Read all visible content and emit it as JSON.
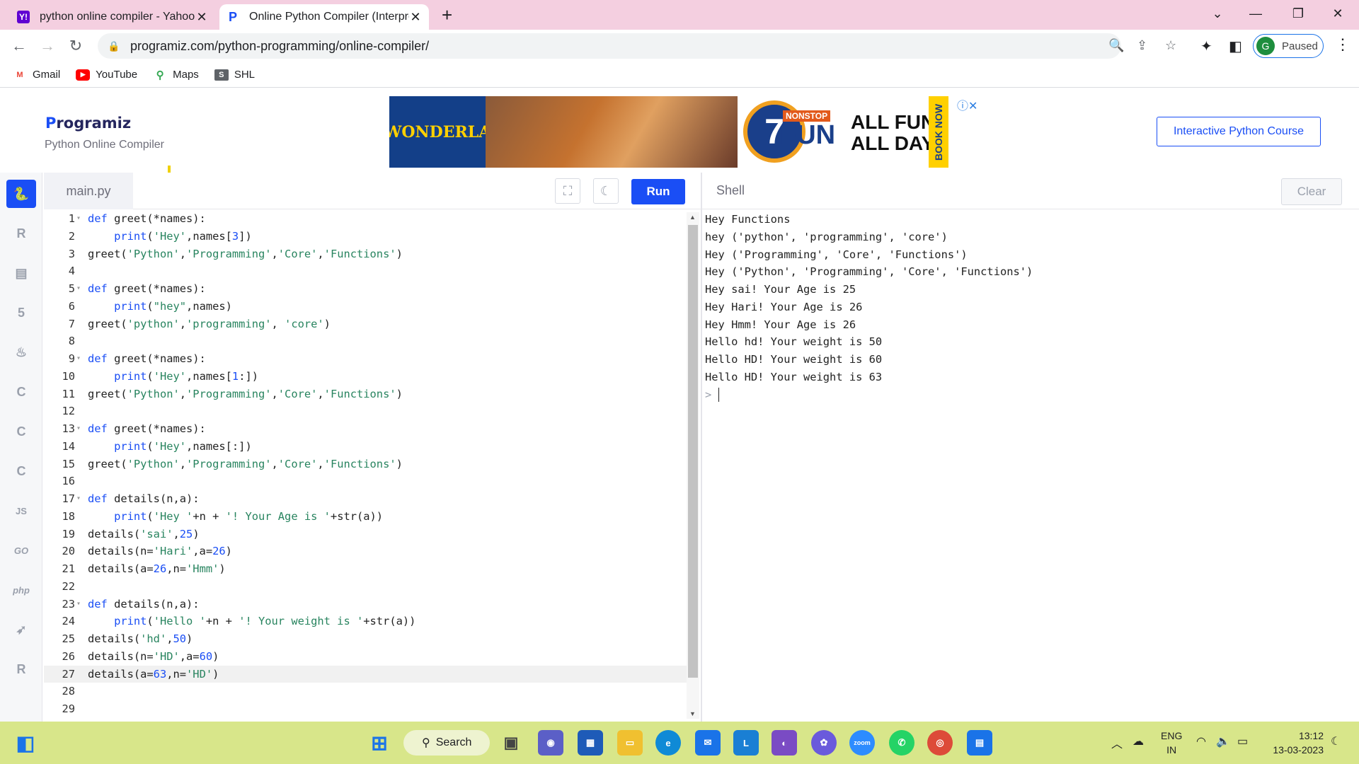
{
  "browser": {
    "tabs": [
      {
        "title": "python online compiler - Yahoo",
        "favicon": "Y!",
        "color": "#6001d2"
      },
      {
        "title": "Online Python Compiler (Interpre",
        "favicon": "P",
        "color": "#1a4ef5"
      }
    ],
    "url": "programiz.com/python-programming/online-compiler/",
    "profile": {
      "initial": "G",
      "label": "Paused"
    },
    "bookmarks": [
      {
        "label": "Gmail",
        "icon": "gmail-icon"
      },
      {
        "label": "YouTube",
        "icon": "youtube-icon"
      },
      {
        "label": "Maps",
        "icon": "maps-icon"
      },
      {
        "label": "SHL",
        "icon": "shl-icon"
      }
    ]
  },
  "site": {
    "logo": "Programiz",
    "subtitle": "Python Online Compiler",
    "course_button": "Interactive Python Course",
    "ad": {
      "brand": "WONDERLA",
      "number": "7",
      "badge": "NONSTOP",
      "fun": "FUN",
      "tagline": "ALL FUN, ALL DAY.",
      "cta": "BOOK NOW"
    }
  },
  "editor": {
    "filename": "main.py",
    "run_label": "Run",
    "current_line": 27,
    "lines": [
      {
        "n": "1",
        "fold": true,
        "html": "<span class=\"kw\">def</span> greet(*names):"
      },
      {
        "n": "2",
        "html": "    <span class=\"kw\">print</span>(<span class=\"str\">'Hey'</span>,names[<span class=\"nm\">3</span>])"
      },
      {
        "n": "3",
        "html": "greet(<span class=\"str\">'Python'</span>,<span class=\"str\">'Programming'</span>,<span class=\"str\">'Core'</span>,<span class=\"str\">'Functions'</span>)"
      },
      {
        "n": "4",
        "html": ""
      },
      {
        "n": "5",
        "fold": true,
        "html": "<span class=\"kw\">def</span> greet(*names):"
      },
      {
        "n": "6",
        "html": "    <span class=\"kw\">print</span>(<span class=\"str\">\"hey\"</span>,names)"
      },
      {
        "n": "7",
        "html": "greet(<span class=\"str\">'python'</span>,<span class=\"str\">'programming'</span>, <span class=\"str\">'core'</span>)"
      },
      {
        "n": "8",
        "html": ""
      },
      {
        "n": "9",
        "fold": true,
        "html": "<span class=\"kw\">def</span> greet(*names):"
      },
      {
        "n": "10",
        "html": "    <span class=\"kw\">print</span>(<span class=\"str\">'Hey'</span>,names[<span class=\"nm\">1</span>:])"
      },
      {
        "n": "11",
        "html": "greet(<span class=\"str\">'Python'</span>,<span class=\"str\">'Programming'</span>,<span class=\"str\">'Core'</span>,<span class=\"str\">'Functions'</span>)"
      },
      {
        "n": "12",
        "html": ""
      },
      {
        "n": "13",
        "fold": true,
        "html": "<span class=\"kw\">def</span> greet(*names):"
      },
      {
        "n": "14",
        "html": "    <span class=\"kw\">print</span>(<span class=\"str\">'Hey'</span>,names[:])"
      },
      {
        "n": "15",
        "html": "greet(<span class=\"str\">'Python'</span>,<span class=\"str\">'Programming'</span>,<span class=\"str\">'Core'</span>,<span class=\"str\">'Functions'</span>)"
      },
      {
        "n": "16",
        "html": ""
      },
      {
        "n": "17",
        "fold": true,
        "html": "<span class=\"kw\">def</span> details(n,a):"
      },
      {
        "n": "18",
        "html": "    <span class=\"kw\">print</span>(<span class=\"str\">'Hey '</span>+n + <span class=\"str\">'! Your Age is '</span>+str(a))"
      },
      {
        "n": "19",
        "html": "details(<span class=\"str\">'sai'</span>,<span class=\"nm\">25</span>)"
      },
      {
        "n": "20",
        "html": "details(n=<span class=\"str\">'Hari'</span>,a=<span class=\"nm\">26</span>)"
      },
      {
        "n": "21",
        "html": "details(a=<span class=\"nm\">26</span>,n=<span class=\"str\">'Hmm'</span>)"
      },
      {
        "n": "22",
        "html": ""
      },
      {
        "n": "23",
        "fold": true,
        "html": "<span class=\"kw\">def</span> details(n,a):"
      },
      {
        "n": "24",
        "html": "    <span class=\"kw\">print</span>(<span class=\"str\">'Hello '</span>+n + <span class=\"str\">'! Your weight is '</span>+str(a))"
      },
      {
        "n": "25",
        "html": "details(<span class=\"str\">'hd'</span>,<span class=\"nm\">50</span>)"
      },
      {
        "n": "26",
        "html": "details(n=<span class=\"str\">'HD'</span>,a=<span class=\"nm\">60</span>)"
      },
      {
        "n": "27",
        "html": "details(a=<span class=\"nm\">63</span>,n=<span class=\"str\">'HD'</span>)"
      },
      {
        "n": "28",
        "html": ""
      },
      {
        "n": "29",
        "html": ""
      }
    ]
  },
  "shell": {
    "title": "Shell",
    "clear_label": "Clear",
    "output": [
      "Hey Functions",
      "hey ('python', 'programming', 'core')",
      "Hey ('Programming', 'Core', 'Functions')",
      "Hey ('Python', 'Programming', 'Core', 'Functions')",
      "Hey sai! Your Age is 25",
      "Hey Hari! Your Age is 26",
      "Hey Hmm! Your Age is 26",
      "Hello hd! Your weight is 50",
      "Hello HD! Your weight is 60",
      "Hello HD! Your weight is 63"
    ],
    "prompt": ">"
  },
  "sidebar": {
    "items": [
      {
        "name": "python",
        "label": "",
        "active": true
      },
      {
        "name": "r",
        "label": "R"
      },
      {
        "name": "sql",
        "label": ""
      },
      {
        "name": "html",
        "label": "5"
      },
      {
        "name": "java",
        "label": ""
      },
      {
        "name": "c",
        "label": "C"
      },
      {
        "name": "cpp",
        "label": "C"
      },
      {
        "name": "csharp",
        "label": "C"
      },
      {
        "name": "js",
        "label": "JS"
      },
      {
        "name": "go",
        "label": "GO"
      },
      {
        "name": "php",
        "label": "php"
      },
      {
        "name": "swift",
        "label": ""
      },
      {
        "name": "rust",
        "label": "R"
      }
    ]
  },
  "taskbar": {
    "search": "Search",
    "lang": "ENG",
    "region": "IN",
    "time": "13:12",
    "date": "13-03-2023"
  }
}
